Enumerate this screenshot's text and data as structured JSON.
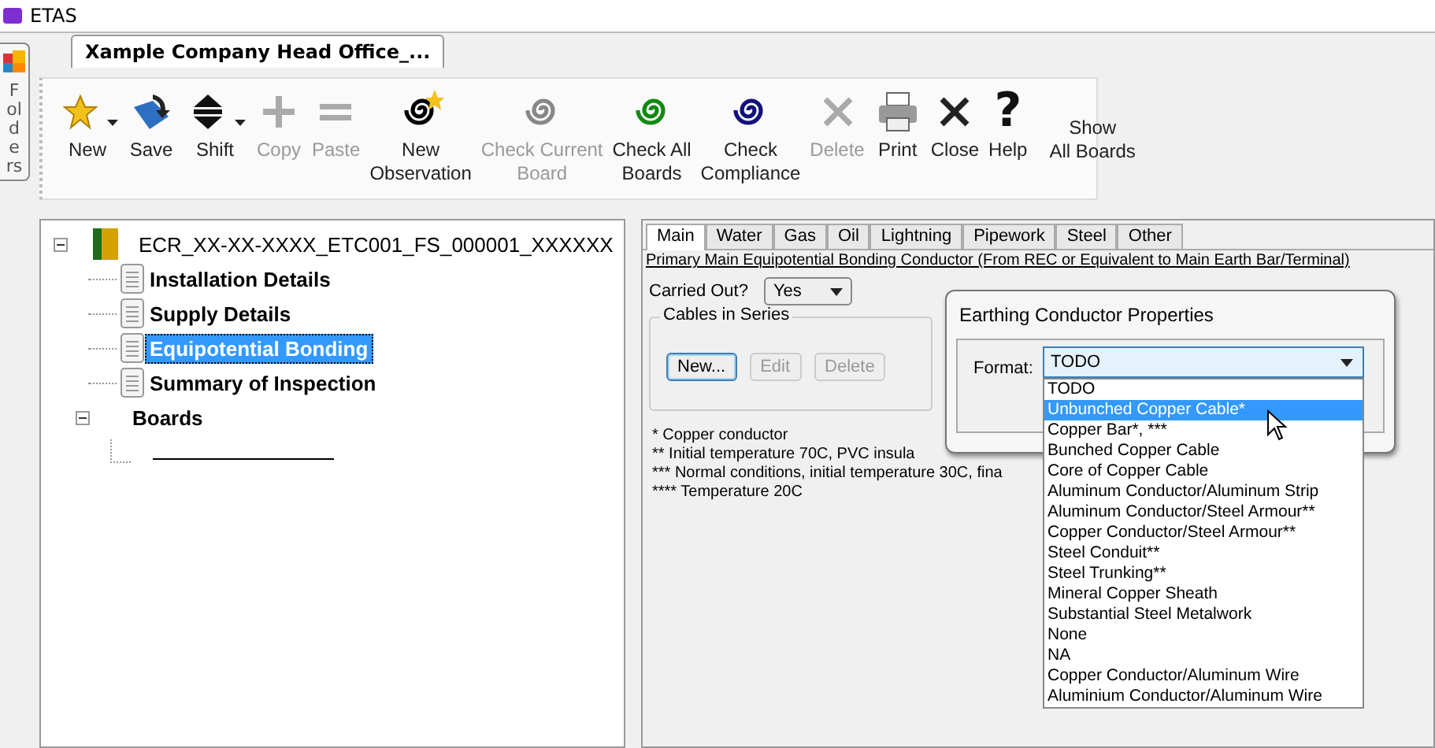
{
  "window": {
    "title": "ETAS"
  },
  "side_strip": {
    "label": "Folders"
  },
  "document_tab": {
    "label": "Xample Company Head Office_...",
    "selected": true
  },
  "toolbar": [
    {
      "label": "New",
      "disabled": false,
      "dropdown": true
    },
    {
      "label": "Save",
      "disabled": false,
      "dropdown": false
    },
    {
      "label": "Shift",
      "disabled": false,
      "dropdown": true
    },
    {
      "label": "Copy",
      "disabled": true,
      "dropdown": false
    },
    {
      "label": "Paste",
      "disabled": true,
      "dropdown": false
    },
    {
      "label": "New\nObservation",
      "disabled": false,
      "dropdown": false
    },
    {
      "label": "Check Current\nBoard",
      "disabled": true,
      "dropdown": false
    },
    {
      "label": "Check All\nBoards",
      "disabled": false,
      "dropdown": false
    },
    {
      "label": "Check\nCompliance",
      "disabled": false,
      "dropdown": false
    },
    {
      "label": "Delete",
      "disabled": true,
      "dropdown": false
    },
    {
      "label": "Print",
      "disabled": false,
      "dropdown": false
    },
    {
      "label": "Close",
      "disabled": false,
      "dropdown": false
    },
    {
      "label": "Help",
      "disabled": false,
      "dropdown": false,
      "glyph": "?"
    }
  ],
  "show_all_boards": {
    "label": "Show\nAll Boards"
  },
  "tree": {
    "label": "ECR_XX-XX-XXXX_ETC001_FS_000001_XXXXXX",
    "expanded": true,
    "selected": false,
    "children": [
      {
        "label": "Installation Details",
        "selected": false
      },
      {
        "label": "Supply Details",
        "selected": false
      },
      {
        "label": "Equipotential Bonding",
        "selected": true
      },
      {
        "label": "Summary of Inspection",
        "selected": false
      },
      {
        "label": "Boards",
        "selected": false,
        "expanded": true,
        "kind": "group"
      }
    ]
  },
  "tabs": [
    {
      "label": "Main",
      "selected": true
    },
    {
      "label": "Water",
      "selected": false
    },
    {
      "label": "Gas",
      "selected": false
    },
    {
      "label": "Oil",
      "selected": false
    },
    {
      "label": "Lightning",
      "selected": false
    },
    {
      "label": "Pipework",
      "selected": false
    },
    {
      "label": "Steel",
      "selected": false
    },
    {
      "label": "Other",
      "selected": false
    }
  ],
  "section_title": "Primary Main Equipotential Bonding Conductor (From REC or Equivalent to Main Earth Bar/Terminal)",
  "carried_out": {
    "label": "Carried Out?",
    "value": "Yes"
  },
  "cables": {
    "title": "Cables in Series",
    "buttons": [
      {
        "label": "New...",
        "disabled": false
      },
      {
        "label": "Edit",
        "disabled": true
      },
      {
        "label": "Delete",
        "disabled": true
      }
    ]
  },
  "footnotes": [
    "* Copper conductor",
    "** Initial temperature 70C, PVC insula",
    "*** Normal conditions, initial temperature 30C, fina",
    "**** Temperature 20C"
  ],
  "dialog": {
    "title": "Earthing Conductor Properties",
    "format_label": "Format:",
    "format_value": "TODO",
    "options": [
      {
        "label": "TODO",
        "selected": false
      },
      {
        "label": "Unbunched Copper Cable*",
        "selected": true
      },
      {
        "label": "Copper Bar*, ***",
        "selected": false
      },
      {
        "label": "Bunched Copper Cable",
        "selected": false
      },
      {
        "label": "Core of Copper Cable",
        "selected": false
      },
      {
        "label": "Aluminum Conductor/Aluminum Strip",
        "selected": false
      },
      {
        "label": "Aluminum Conductor/Steel Armour**",
        "selected": false
      },
      {
        "label": "Copper Conductor/Steel Armour**",
        "selected": false
      },
      {
        "label": "Steel Conduit**",
        "selected": false
      },
      {
        "label": "Steel Trunking**",
        "selected": false
      },
      {
        "label": "Mineral Copper Sheath",
        "selected": false
      },
      {
        "label": "Substantial Steel Metalwork",
        "selected": false
      },
      {
        "label": "None",
        "selected": false
      },
      {
        "label": "NA",
        "selected": false
      },
      {
        "label": "Copper Conductor/Aluminum Wire",
        "selected": false
      },
      {
        "label": "Aluminium Conductor/Aluminum Wire",
        "selected": false
      }
    ]
  }
}
